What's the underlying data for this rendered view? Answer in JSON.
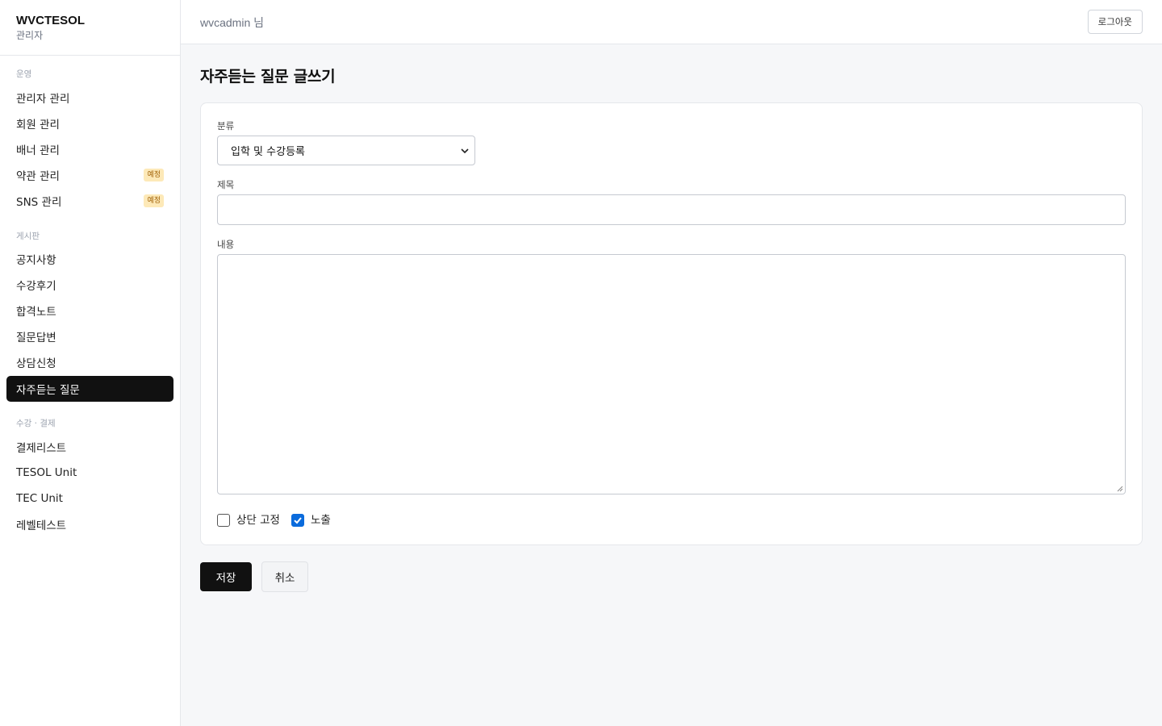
{
  "brand": {
    "title": "WVCTESOL",
    "subtitle": "관리자"
  },
  "topbar": {
    "user": "wvcadmin 님",
    "logout_label": "로그아웃"
  },
  "sidebar": {
    "sections": [
      {
        "label": "운영",
        "items": [
          {
            "label": "관리자 관리"
          },
          {
            "label": "회원 관리"
          },
          {
            "label": "배너 관리"
          },
          {
            "label": "약관 관리",
            "badge": "예정"
          },
          {
            "label": "SNS 관리",
            "badge": "예정"
          }
        ]
      },
      {
        "label": "게시판",
        "items": [
          {
            "label": "공지사항"
          },
          {
            "label": "수강후기"
          },
          {
            "label": "합격노트"
          },
          {
            "label": "질문답변"
          },
          {
            "label": "상담신청"
          },
          {
            "label": "자주듣는 질문",
            "active": true
          }
        ]
      },
      {
        "label": "수강 · 결제",
        "items": [
          {
            "label": "결제리스트"
          },
          {
            "label": "TESOL Unit"
          },
          {
            "label": "TEC Unit"
          },
          {
            "label": "레벨테스트"
          }
        ]
      }
    ]
  },
  "page": {
    "title": "자주듣는 질문 글쓰기",
    "form": {
      "category_label": "분류",
      "category_value": "입학 및 수강등록",
      "title_label": "제목",
      "title_value": "",
      "content_label": "내용",
      "content_value": "",
      "pin_label": "상단 고정",
      "pin_checked": false,
      "visible_label": "노출",
      "visible_checked": true
    },
    "save_label": "저장",
    "cancel_label": "취소"
  },
  "colors": {
    "accent": "#111111",
    "checkbox": "#0b6bdc",
    "badge_bg": "#fde9b8",
    "badge_text": "#a16207"
  }
}
